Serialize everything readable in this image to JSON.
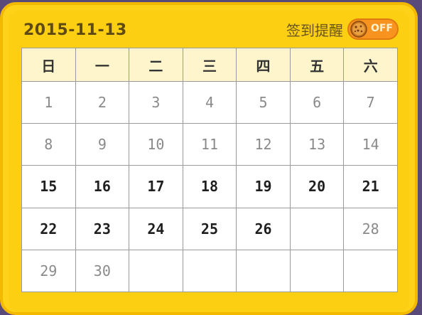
{
  "header": {
    "date": "2015-11-13",
    "reminder_label": "签到提醒",
    "toggle_state": "OFF"
  },
  "weekdays": [
    "日",
    "一",
    "二",
    "三",
    "四",
    "五",
    "六"
  ],
  "weeks": [
    [
      {
        "day": "1",
        "state": "past"
      },
      {
        "day": "2",
        "state": "past"
      },
      {
        "day": "3",
        "state": "past"
      },
      {
        "day": "4",
        "state": "past"
      },
      {
        "day": "5",
        "state": "past"
      },
      {
        "day": "6",
        "state": "past"
      },
      {
        "day": "7",
        "state": "past"
      }
    ],
    [
      {
        "day": "8",
        "state": "past"
      },
      {
        "day": "9",
        "state": "past"
      },
      {
        "day": "10",
        "state": "past"
      },
      {
        "day": "11",
        "state": "past"
      },
      {
        "day": "12",
        "state": "past"
      },
      {
        "day": "13",
        "state": "past"
      },
      {
        "day": "14",
        "state": "past"
      }
    ],
    [
      {
        "day": "15",
        "state": "active"
      },
      {
        "day": "16",
        "state": "active"
      },
      {
        "day": "17",
        "state": "active"
      },
      {
        "day": "18",
        "state": "active"
      },
      {
        "day": "19",
        "state": "active"
      },
      {
        "day": "20",
        "state": "active"
      },
      {
        "day": "21",
        "state": "active"
      }
    ],
    [
      {
        "day": "22",
        "state": "active"
      },
      {
        "day": "23",
        "state": "active"
      },
      {
        "day": "24",
        "state": "active"
      },
      {
        "day": "25",
        "state": "active"
      },
      {
        "day": "26",
        "state": "active"
      },
      {
        "day": "",
        "state": "empty"
      },
      {
        "day": "28",
        "state": "past"
      }
    ],
    [
      {
        "day": "29",
        "state": "past"
      },
      {
        "day": "30",
        "state": "past"
      },
      {
        "day": "",
        "state": "empty"
      },
      {
        "day": "",
        "state": "empty"
      },
      {
        "day": "",
        "state": "empty"
      },
      {
        "day": "",
        "state": "empty"
      },
      {
        "day": "",
        "state": "empty"
      }
    ]
  ],
  "colors": {
    "panel": "#ffd21a",
    "panel_border": "#f2b900",
    "header_row": "#fef5cc",
    "toggle_off": "#f7931e",
    "active_day": "#1f1f1f",
    "past_day": "#8a8a8a"
  },
  "icons": {
    "toggle_knob": "cookie-icon"
  }
}
